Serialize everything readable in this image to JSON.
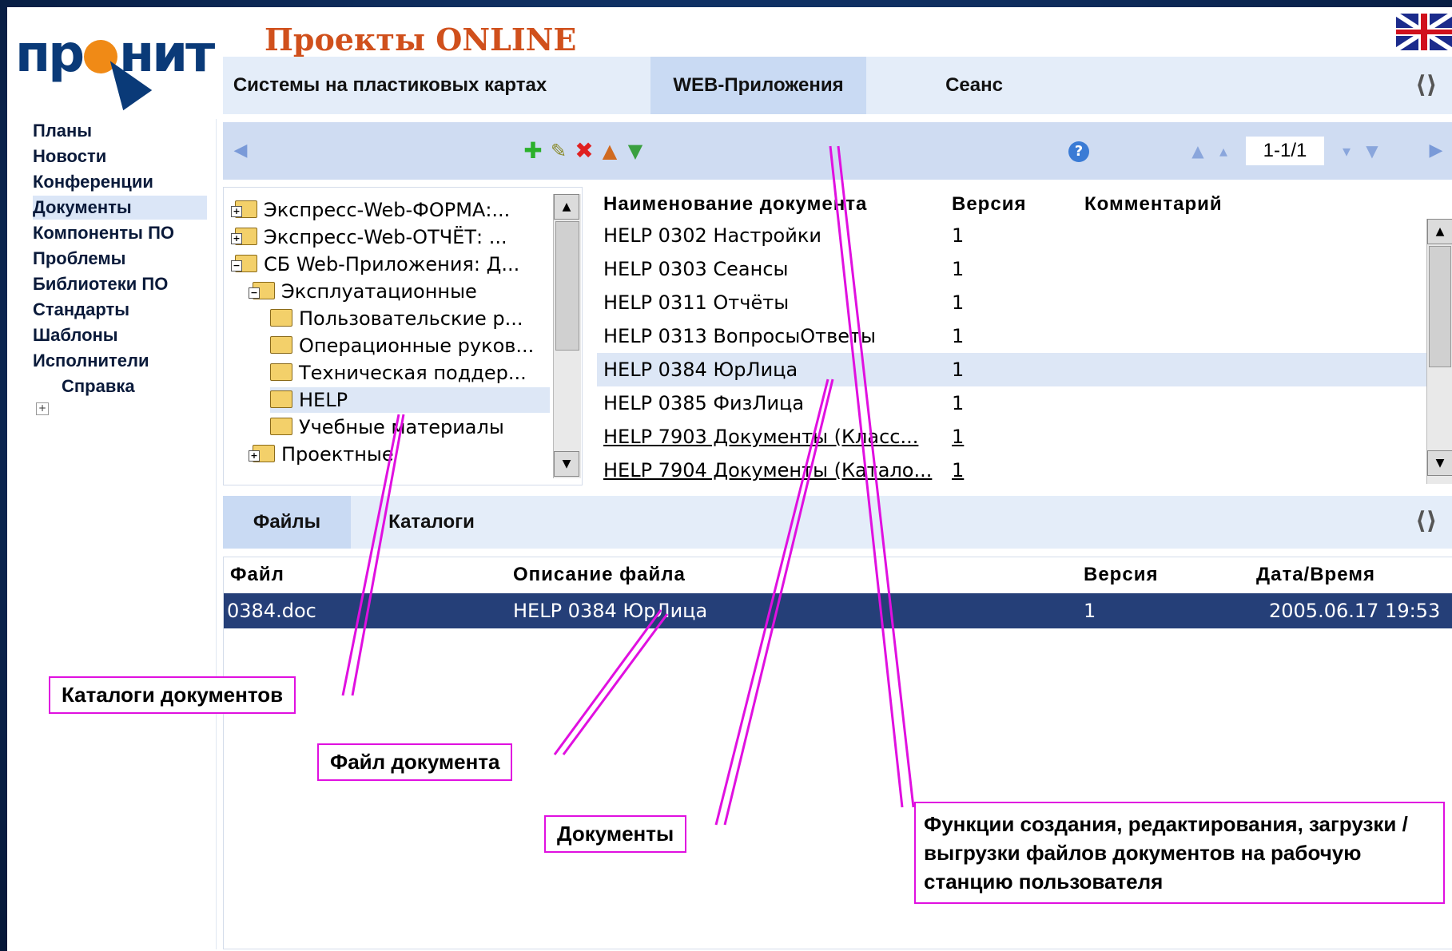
{
  "logo": {
    "brand": "ПРОНИТ"
  },
  "app_title": "Проекты ONLINE",
  "top_tabs": [
    {
      "label": "Системы на пластиковых картах"
    },
    {
      "label": "WEB-Приложения"
    },
    {
      "label": "Сеанс"
    }
  ],
  "sidebar": {
    "items": [
      {
        "label": "Планы"
      },
      {
        "label": "Новости"
      },
      {
        "label": "Конференции"
      },
      {
        "label": "Документы"
      },
      {
        "label": "Компоненты ПО"
      },
      {
        "label": "Проблемы"
      },
      {
        "label": "Библиотеки ПО"
      },
      {
        "label": "Стандарты"
      },
      {
        "label": "Шаблоны"
      },
      {
        "label": "Исполнители"
      },
      {
        "label": "Справка"
      }
    ],
    "expand_symbol": "+"
  },
  "toolbar": {
    "icons": [
      "back-arrow-icon",
      "add-icon",
      "edit-icon",
      "delete-icon",
      "upload-icon",
      "download-icon",
      "help-icon",
      "first-page-icon",
      "prev-page-icon",
      "next-page-icon",
      "last-page-icon",
      "forward-arrow-icon"
    ],
    "pager": "1-1/1"
  },
  "tree": {
    "items": [
      {
        "label": "Экспресс-Web-ФОРМА:..."
      },
      {
        "label": "Экспресс-Web-ОТЧЁТ: ..."
      },
      {
        "label": "СБ Web-Приложения: Д..."
      },
      {
        "label": "Эксплуатационные"
      },
      {
        "label": "Пользовательские р..."
      },
      {
        "label": "Операционные руков..."
      },
      {
        "label": "Техническая поддер..."
      },
      {
        "label": "HELP"
      },
      {
        "label": "Учебные материалы"
      },
      {
        "label": "Проектные"
      }
    ]
  },
  "documents": {
    "headers": {
      "name": "Наименование документа",
      "version": "Версия",
      "comment": "Комментарий"
    },
    "rows": [
      {
        "name": "HELP 0302 Настройки",
        "version": "1"
      },
      {
        "name": "HELP 0303 Сеансы",
        "version": "1"
      },
      {
        "name": "HELP 0311 Отчёты",
        "version": "1"
      },
      {
        "name": "HELP 0313 ВопросыОтветы",
        "version": "1"
      },
      {
        "name": "HELP 0384 ЮрЛица",
        "version": "1"
      },
      {
        "name": "HELP 0385 ФизЛица",
        "version": "1"
      },
      {
        "name": "HELP 7903 Документы (Класс...",
        "version": "1"
      },
      {
        "name": "HELP 7904 Документы (Катало...",
        "version": "1"
      }
    ]
  },
  "bottom_tabs": [
    {
      "label": "Файлы"
    },
    {
      "label": "Каталоги"
    }
  ],
  "files": {
    "headers": {
      "file": "Файл",
      "description": "Описание файла",
      "version": "Версия",
      "datetime": "Дата/Время"
    },
    "rows": [
      {
        "file": "0384.doc",
        "description": "HELP 0384 ЮрЛица",
        "version": "1",
        "datetime": "2005.06.17 19:53"
      }
    ]
  },
  "callouts": {
    "catalogs": "Каталоги документов",
    "file": "Файл документа",
    "documents": "Документы",
    "functions": "Функции создания, редактирования, загрузки / выгрузки файлов документов на рабочую станцию пользователя"
  },
  "colors": {
    "accent": "#e010e0",
    "selected_row": "#253f78",
    "tab_bar": "#e4edf9",
    "title": "#d0501c"
  }
}
